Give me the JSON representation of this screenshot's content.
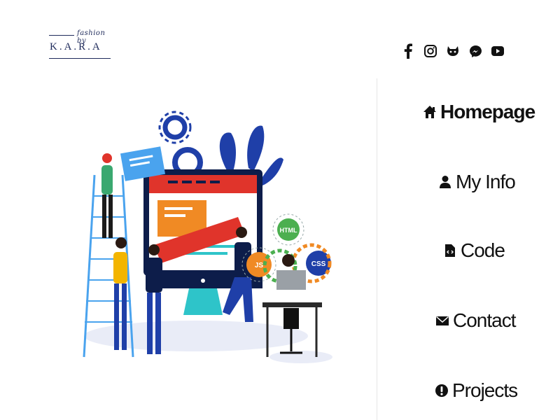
{
  "logo": {
    "script_text": "fashion by",
    "brand_text": "K.A.R.A"
  },
  "social": [
    {
      "name": "facebook-icon"
    },
    {
      "name": "instagram-icon"
    },
    {
      "name": "github-icon"
    },
    {
      "name": "messenger-icon"
    },
    {
      "name": "youtube-icon"
    }
  ],
  "nav": {
    "items": [
      {
        "label": "Homepage",
        "icon": "home-icon",
        "active": true
      },
      {
        "label": "My Info",
        "icon": "user-icon",
        "active": false
      },
      {
        "label": "Code",
        "icon": "code-file-icon",
        "active": false
      },
      {
        "label": "Contact",
        "icon": "envelope-icon",
        "active": false
      },
      {
        "label": "Projects",
        "icon": "exclamation-circle-icon",
        "active": false
      }
    ]
  },
  "illustration": {
    "badges": [
      "HTML",
      "JS",
      "CSS"
    ]
  },
  "colors": {
    "text": "#111111",
    "brand_navy": "#1e2a5a",
    "accent_blue": "#1f3fa8",
    "accent_red": "#e0342b",
    "accent_orange": "#f08a24",
    "accent_green": "#4caf50"
  }
}
